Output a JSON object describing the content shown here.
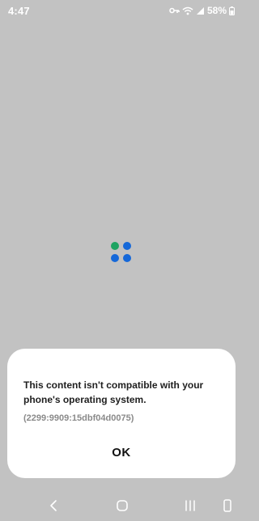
{
  "status_bar": {
    "time": "4:47",
    "battery_percent": "58%",
    "icons": [
      "key-icon",
      "wifi-calling-icon",
      "signal-icon",
      "battery-icon"
    ]
  },
  "loader": {
    "colors": [
      "#1ea362",
      "#1568d9",
      "#1568d9",
      "#1568d9"
    ]
  },
  "dialog": {
    "message": "This content isn't compatible with your phone's operating system.",
    "error_code": "(2299:9909:15dbf04d0075)",
    "ok_label": "OK"
  },
  "nav_bar": {
    "buttons": [
      "back-icon",
      "home-icon",
      "recents-icon",
      "rotate-icon"
    ]
  }
}
